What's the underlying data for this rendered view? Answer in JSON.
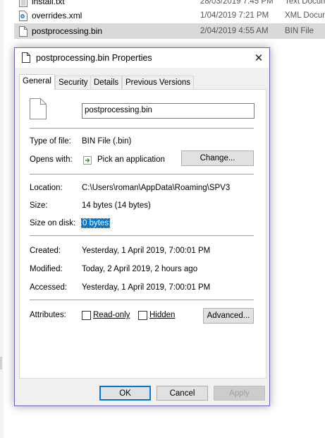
{
  "explorer": {
    "files": [
      {
        "name": "install.txt",
        "date": "28/03/2019 7:45 PM",
        "type": "Text Docum",
        "icon": "text-file-icon",
        "selected": false
      },
      {
        "name": "overrides.xml",
        "date": "1/04/2019 7:21 PM",
        "type": "XML Docum",
        "icon": "xml-file-icon",
        "selected": false
      },
      {
        "name": "postprocessing.bin",
        "date": "2/04/2019 4:55 AM",
        "type": "BIN File",
        "icon": "file-icon",
        "selected": true
      }
    ]
  },
  "dialog": {
    "title": "postprocessing.bin Properties",
    "close_glyph": "✕",
    "tabs": [
      "General",
      "Security",
      "Details",
      "Previous Versions"
    ],
    "active_tab": "General",
    "general": {
      "file_name": "postprocessing.bin",
      "type_label": "Type of file:",
      "type_value": "BIN File (.bin)",
      "opens_label": "Opens with:",
      "opens_value": "Pick an application",
      "change_button": "Change...",
      "location_label": "Location:",
      "location_value": "C:\\Users\\roman\\AppData\\Roaming\\SPV3",
      "size_label": "Size:",
      "size_value": "14 bytes (14 bytes)",
      "size_disk_label": "Size on disk:",
      "size_disk_value": "0 bytes",
      "created_label": "Created:",
      "created_value": "Yesterday, 1 April 2019, 7:00:01 PM",
      "modified_label": "Modified:",
      "modified_value": "Today, 2 April 2019, 2 hours ago",
      "accessed_label": "Accessed:",
      "accessed_value": "Yesterday, 1 April 2019, 7:00:01 PM",
      "attributes_label": "Attributes:",
      "readonly_label": "Read-only",
      "hidden_label": "Hidden",
      "advanced_button": "Advanced..."
    },
    "buttons": {
      "ok": "OK",
      "cancel": "Cancel",
      "apply": "Apply"
    }
  },
  "colors": {
    "accent": "#0078d7",
    "dialog_border": "#6f5fb8",
    "selection": "#d9d9d9"
  }
}
